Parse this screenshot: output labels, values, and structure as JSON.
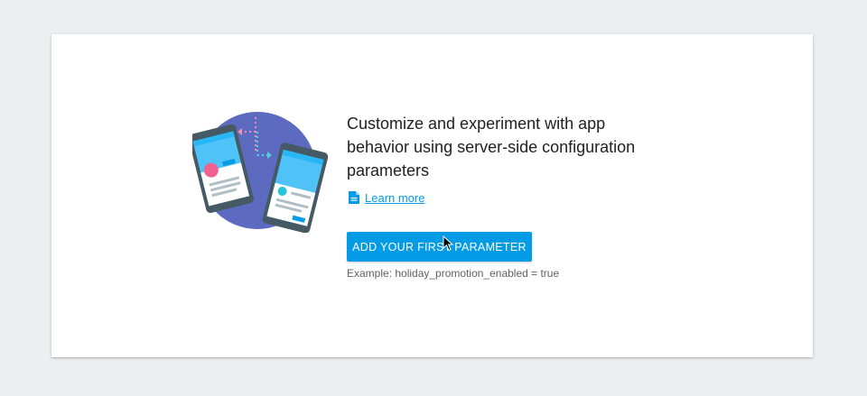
{
  "empty_state": {
    "headline": "Customize and experiment with app behavior using server-side configuration parameters",
    "learn_more_label": "Learn more",
    "primary_button_label": "ADD YOUR FIRST PARAMETER",
    "example_text": "Example: holiday_promotion_enabled = true"
  },
  "icons": {
    "learn_more": "document-icon",
    "illustration": "phones-config-illustration",
    "pointer": "mouse-cursor-icon"
  },
  "colors": {
    "accent": "#039be5",
    "page_background": "#eceff1",
    "illustration_circle": "#5c6bc0",
    "phone_screen": "#4fc3f7",
    "pink_dot": "#f06292",
    "teal_dot": "#26c6da"
  }
}
